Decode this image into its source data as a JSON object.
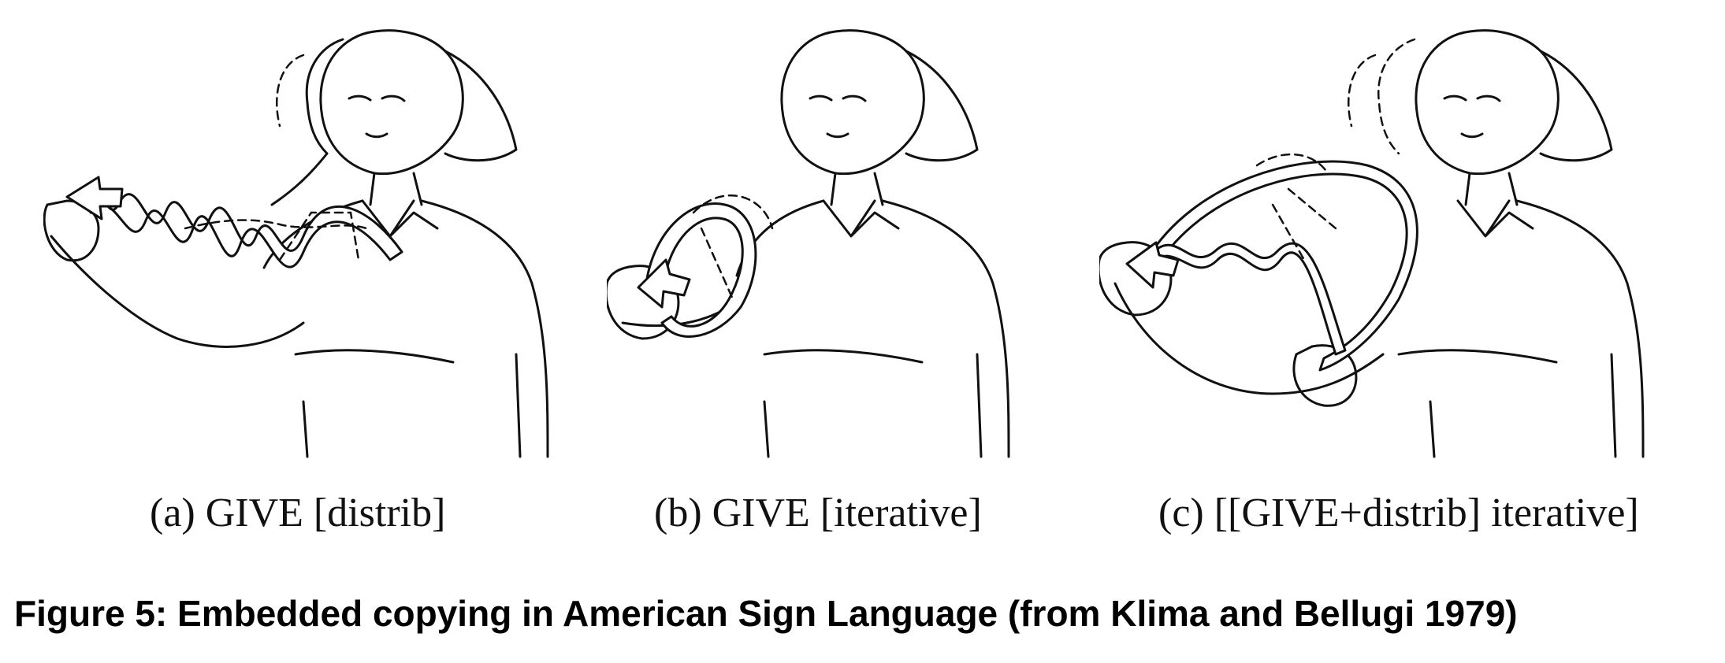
{
  "panels": [
    {
      "caption": "(a) GIVE [distrib]"
    },
    {
      "caption": "(b) GIVE [iterative]"
    },
    {
      "caption": "(c) [[GIVE+distrib] iterative]"
    }
  ],
  "figure_caption": "Figure 5: Embedded copying in American Sign Language (from Klima and Bellugi 1979)"
}
